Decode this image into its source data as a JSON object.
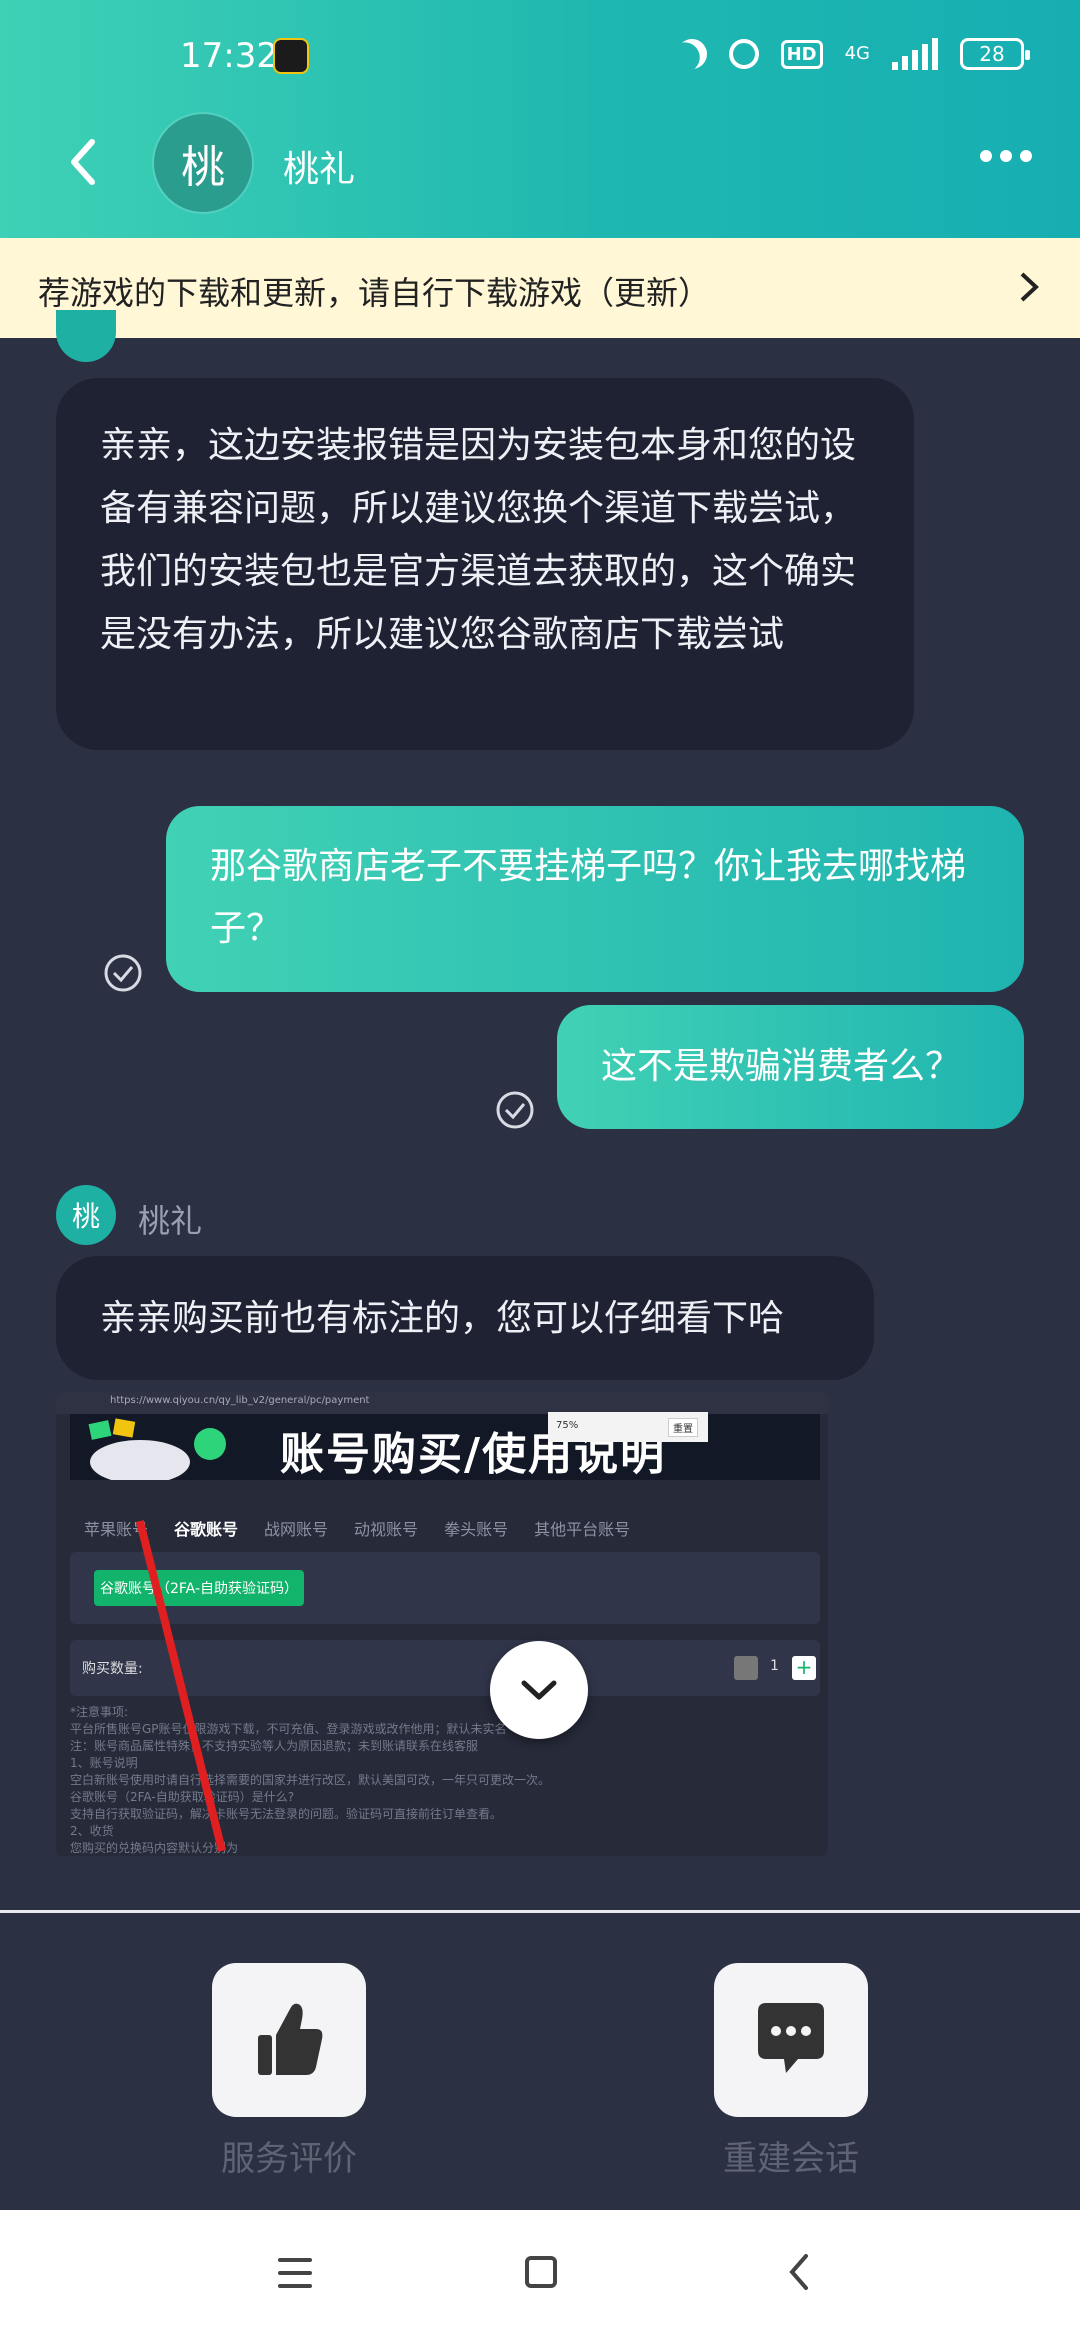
{
  "status_bar": {
    "time": "17:32",
    "network": "4G",
    "hd": "HD",
    "battery": "28"
  },
  "header": {
    "avatar_char": "桃",
    "title": "桃礼"
  },
  "notice": {
    "text": "荐游戏的下载和更新，请自行下载游戏（更新）"
  },
  "messages": [
    {
      "sender": "桃礼",
      "avatar_char": "桃",
      "text": "亲亲，这边安装报错是因为安装包本身和您的设备有兼容问题，所以建议您换个渠道下载尝试，我们的安装包也是官方渠道去获取的，这个确实是没有办法，所以建议您谷歌商店下载尝试"
    },
    {
      "text": "那谷歌商店老子不要挂梯子吗？你让我去哪找梯子？"
    },
    {
      "text": "这不是欺骗消费者么？"
    },
    {
      "sender": "桃礼",
      "avatar_char": "桃",
      "text": "亲亲购买前也有标注的，您可以仔细看下哈"
    }
  ],
  "image_message": {
    "url": "https://www.qiyou.cn/qy_lib_v2/general/pc/payment",
    "banner": "账号购买/使用说明",
    "popup_zoom": "75%",
    "popup_reset": "重置",
    "tabs": [
      "苹果账号",
      "谷歌账号",
      "战网账号",
      "动视账号",
      "拳头账号",
      "其他平台账号"
    ],
    "active_tab": "谷歌账号",
    "option": "谷歌账号（2FA-自助获验证码）",
    "quantity_label": "购买数量:",
    "quantity": "1",
    "notes": [
      "*注意事项:",
      "平台所售账号GP账号仅限游戏下载，不可充值、登录游戏或改作他用；默认未实名",
      "注：账号商品属性特殊，不支持实验等人为原因退款；未到账请联系在线客服",
      "1、账号说明",
      "空白新账号使用时请自行选择需要的国家并进行改区，默认美国可改，一年只可更改一次。",
      "谷歌账号（2FA-自助获取验证码）是什么?",
      "支持自行获取验证码，解决卡账号无法登录的问题。验证码可直接前往订单查看。",
      "2、收货",
      "您购买的兑换码内容默认分别为"
    ]
  },
  "actions": {
    "rate_label": "服务评价",
    "rebuild_label": "重建会话"
  }
}
